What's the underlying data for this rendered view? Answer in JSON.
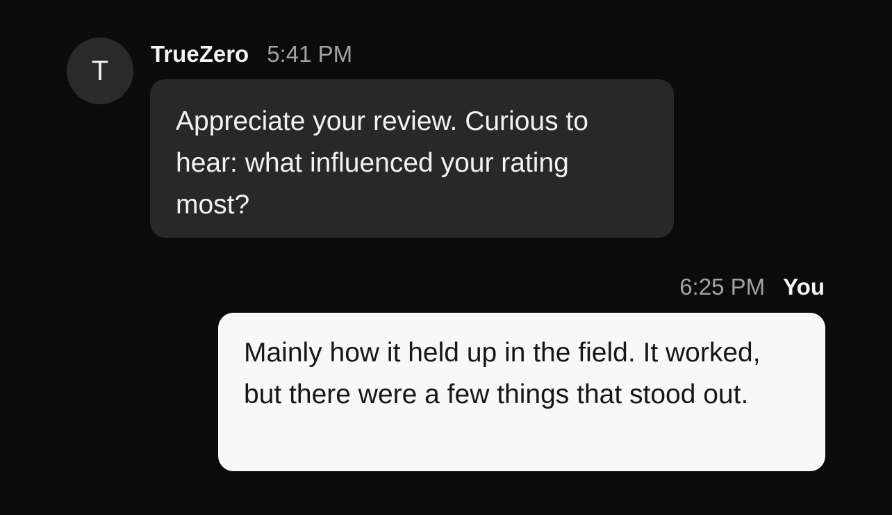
{
  "conversation": {
    "incoming": {
      "avatar_initial": "T",
      "sender": "TrueZero",
      "time": "5:41 PM",
      "text": "Appreciate your review. Curious to hear: what influenced your rating most?"
    },
    "outgoing": {
      "time": "6:25 PM",
      "sender": "You",
      "text": "Mainly how it held up in the field. It worked, but there were a few things that stood out."
    }
  },
  "colors": {
    "background": "#0b0b0b",
    "incoming_bubble": "#282828",
    "outgoing_bubble": "#f8f8f8",
    "timestamp": "#a3a3a3"
  }
}
